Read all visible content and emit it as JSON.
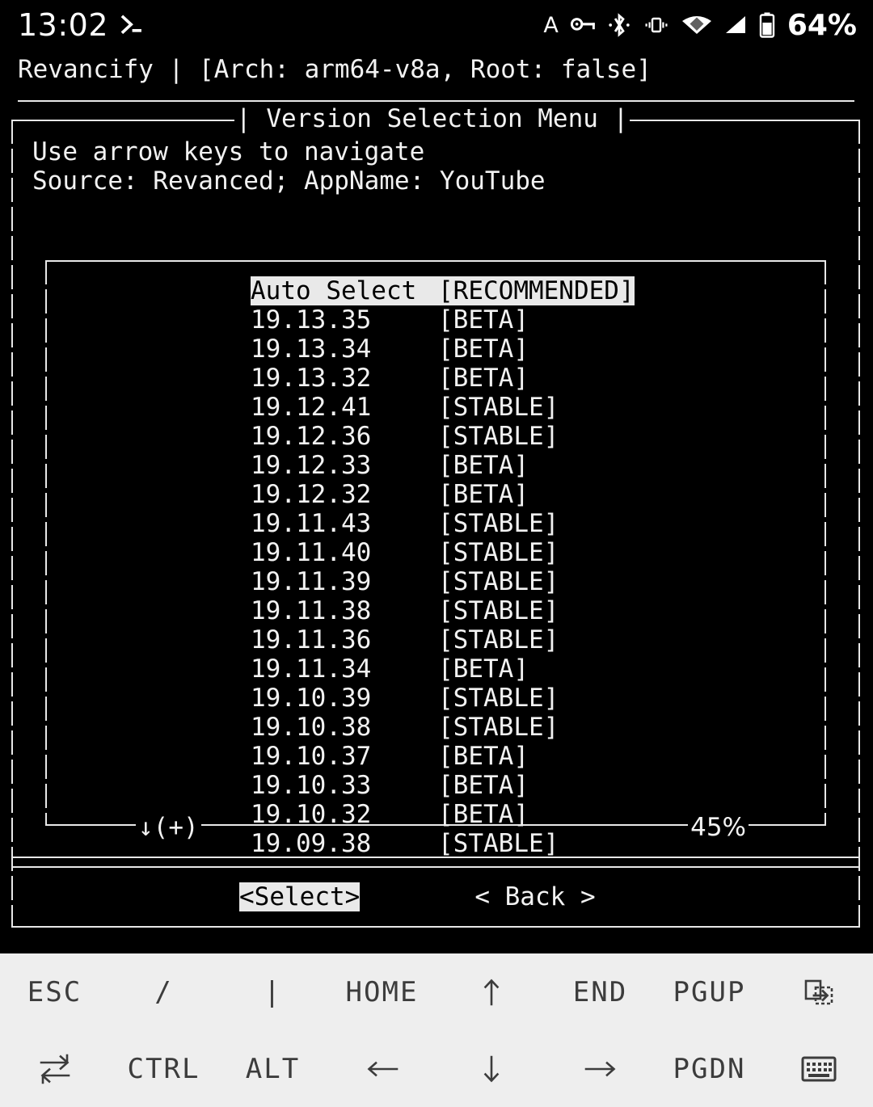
{
  "status_bar": {
    "clock": "13:02",
    "notification_icon": "terminal-prompt-icon",
    "icons": [
      "character-a-icon",
      "vpn-key-icon",
      "bluetooth-icon",
      "vibrate-icon",
      "wifi-icon",
      "cellular-signal-icon",
      "battery-icon"
    ],
    "letter_a": "A",
    "battery_percent": "64%"
  },
  "header": {
    "app_title_line": "Revancify | [Arch: arm64-v8a, Root: false]"
  },
  "dialog": {
    "title": "| Version Selection Menu |",
    "hint_line": "Use arrow keys to navigate",
    "context_line": "Source: Revanced; AppName: YouTube",
    "scroll_indicator": "↓(+)",
    "scroll_percent": "45%",
    "buttons": {
      "select_label": "<Select>",
      "back_label": "< Back >"
    }
  },
  "version_list": {
    "rows": [
      {
        "version": "Auto Select",
        "tag": "[RECOMMENDED]",
        "selected": true
      },
      {
        "version": "19.13.35",
        "tag": "[BETA]",
        "selected": false
      },
      {
        "version": "19.13.34",
        "tag": "[BETA]",
        "selected": false
      },
      {
        "version": "19.13.32",
        "tag": "[BETA]",
        "selected": false
      },
      {
        "version": "19.12.41",
        "tag": "[STABLE]",
        "selected": false
      },
      {
        "version": "19.12.36",
        "tag": "[STABLE]",
        "selected": false
      },
      {
        "version": "19.12.33",
        "tag": "[BETA]",
        "selected": false
      },
      {
        "version": "19.12.32",
        "tag": "[BETA]",
        "selected": false
      },
      {
        "version": "19.11.43",
        "tag": "[STABLE]",
        "selected": false
      },
      {
        "version": "19.11.40",
        "tag": "[STABLE]",
        "selected": false
      },
      {
        "version": "19.11.39",
        "tag": "[STABLE]",
        "selected": false
      },
      {
        "version": "19.11.38",
        "tag": "[STABLE]",
        "selected": false
      },
      {
        "version": "19.11.36",
        "tag": "[STABLE]",
        "selected": false
      },
      {
        "version": "19.11.34",
        "tag": "[BETA]",
        "selected": false
      },
      {
        "version": "19.10.39",
        "tag": "[STABLE]",
        "selected": false
      },
      {
        "version": "19.10.38",
        "tag": "[STABLE]",
        "selected": false
      },
      {
        "version": "19.10.37",
        "tag": "[BETA]",
        "selected": false
      },
      {
        "version": "19.10.33",
        "tag": "[BETA]",
        "selected": false
      },
      {
        "version": "19.10.32",
        "tag": "[BETA]",
        "selected": false
      },
      {
        "version": "19.09.38",
        "tag": "[STABLE]",
        "selected": false
      }
    ]
  },
  "extra_keys": {
    "row1": [
      {
        "label": "ESC",
        "icon": null,
        "name": "key-esc"
      },
      {
        "label": "/",
        "icon": null,
        "name": "key-slash"
      },
      {
        "label": "|",
        "icon": null,
        "name": "key-pipe"
      },
      {
        "label": "HOME",
        "icon": null,
        "name": "key-home"
      },
      {
        "label": "↑",
        "icon": "arrow-up-icon",
        "name": "key-arrow-up"
      },
      {
        "label": "END",
        "icon": null,
        "name": "key-end"
      },
      {
        "label": "PGUP",
        "icon": null,
        "name": "key-pgup"
      },
      {
        "label": "",
        "icon": "paste-icon",
        "name": "key-paste"
      }
    ],
    "row2": [
      {
        "label": "",
        "icon": "tab-icon",
        "name": "key-tab"
      },
      {
        "label": "CTRL",
        "icon": null,
        "name": "key-ctrl"
      },
      {
        "label": "ALT",
        "icon": null,
        "name": "key-alt"
      },
      {
        "label": "←",
        "icon": "arrow-left-icon",
        "name": "key-arrow-left"
      },
      {
        "label": "↓",
        "icon": "arrow-down-icon",
        "name": "key-arrow-down"
      },
      {
        "label": "→",
        "icon": "arrow-right-icon",
        "name": "key-arrow-right"
      },
      {
        "label": "PGDN",
        "icon": null,
        "name": "key-pgdn"
      },
      {
        "label": "",
        "icon": "keyboard-icon",
        "name": "key-keyboard-toggle"
      }
    ]
  },
  "colors": {
    "terminal_bg": "#000000",
    "terminal_fg": "#f2f2f2",
    "highlight_bg": "#e9e9e9",
    "highlight_fg": "#000000",
    "keybar_bg": "#eeeeee",
    "keybar_fg": "#3c3c3c"
  }
}
